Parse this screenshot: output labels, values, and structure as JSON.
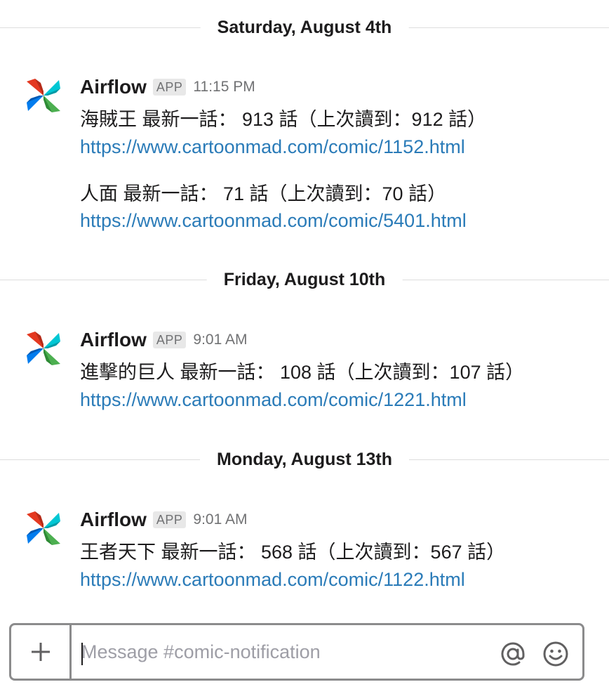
{
  "days": [
    {
      "date": "Saturday, August 4th",
      "messages": [
        {
          "sender": "Airflow",
          "badge": "APP",
          "time": "11:15 PM",
          "entries": [
            {
              "text": "海賊王 最新一話： 913 話（上次讀到：912 話）",
              "url": "https://www.cartoonmad.com/comic/1152.html"
            },
            {
              "text": "人面 最新一話： 71 話（上次讀到：70 話）",
              "url": "https://www.cartoonmad.com/comic/5401.html"
            }
          ]
        }
      ]
    },
    {
      "date": "Friday, August 10th",
      "messages": [
        {
          "sender": "Airflow",
          "badge": "APP",
          "time": "9:01 AM",
          "entries": [
            {
              "text": "進擊的巨人 最新一話： 108 話（上次讀到：107 話）",
              "url": "https://www.cartoonmad.com/comic/1221.html"
            }
          ]
        }
      ]
    },
    {
      "date": "Monday, August 13th",
      "messages": [
        {
          "sender": "Airflow",
          "badge": "APP",
          "time": "9:01 AM",
          "entries": [
            {
              "text": "王者天下 最新一話： 568 話（上次讀到：567 話）",
              "url": "https://www.cartoonmad.com/comic/1122.html"
            }
          ]
        }
      ]
    }
  ],
  "composer": {
    "placeholder": "Message #comic-notification",
    "value": "",
    "icons": {
      "add": "plus-icon",
      "mention": "at-sign-icon",
      "emoji": "smiley-icon"
    }
  },
  "colors": {
    "link": "#2a7bb8",
    "text": "#1d1c1d",
    "muted": "#717274",
    "badge_bg": "#e8e8e8",
    "divider": "#dddddd",
    "composer_border": "#8b8b8c",
    "pinwheel": [
      "#e43921",
      "#00c7d4",
      "#017cee",
      "#4caf50"
    ]
  }
}
